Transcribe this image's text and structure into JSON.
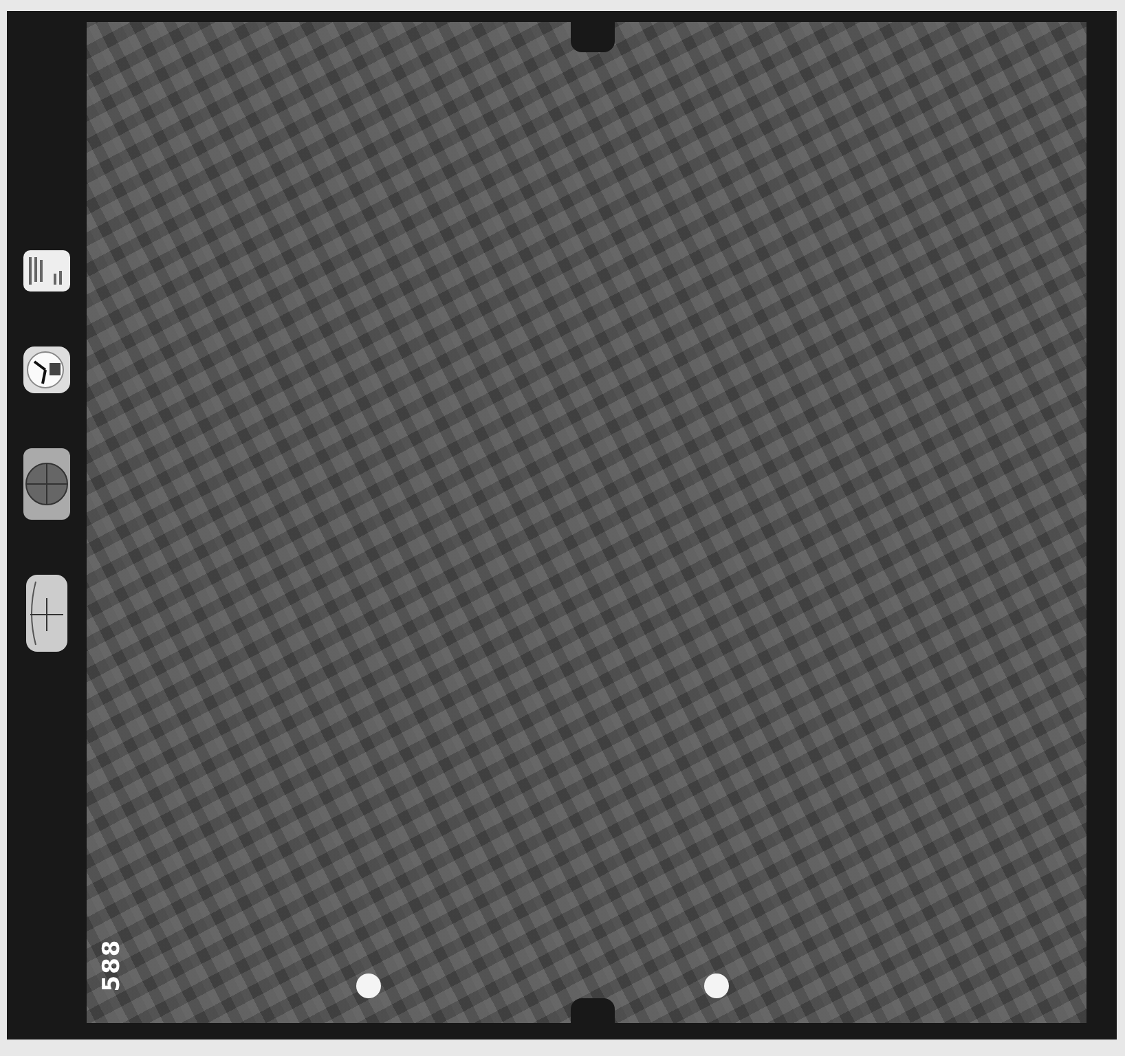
{
  "frame_number": "588"
}
